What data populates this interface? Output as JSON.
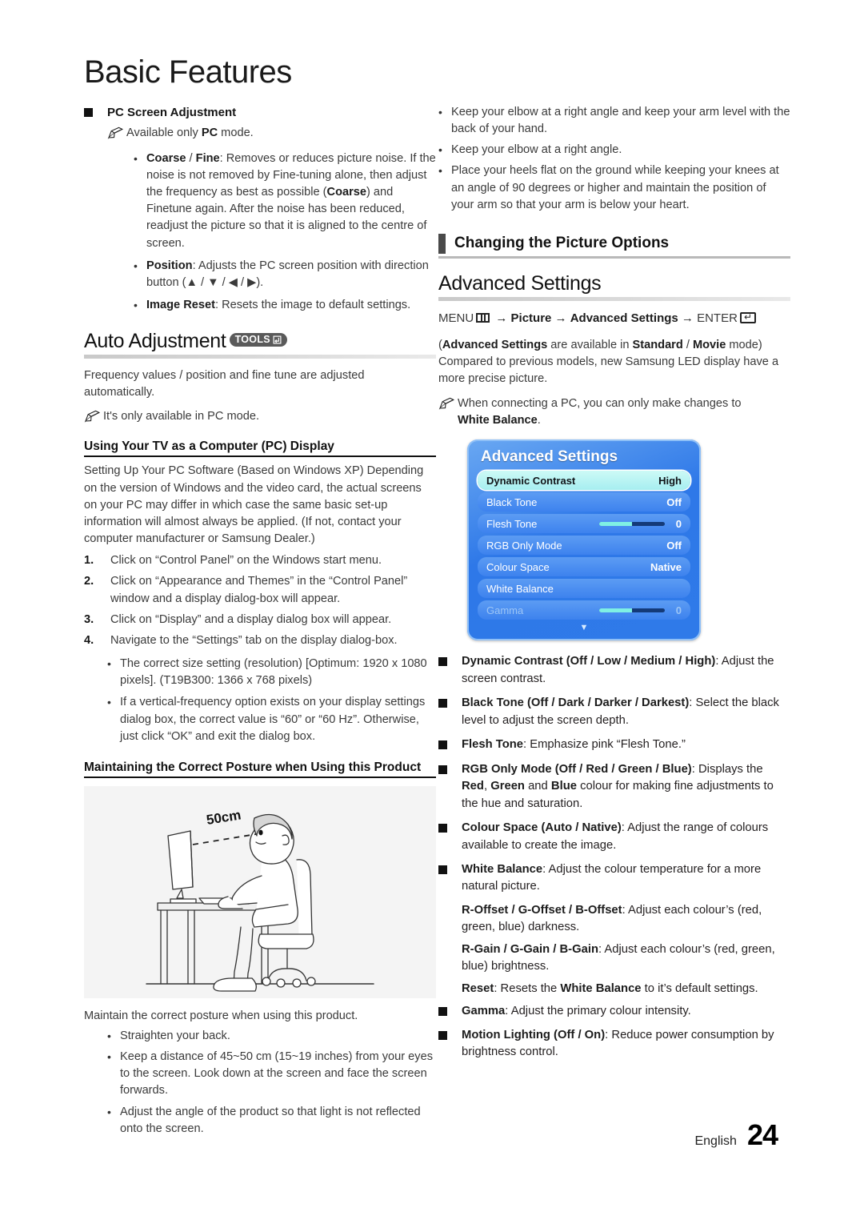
{
  "document": {
    "chapter_title": "Basic Features",
    "footer": {
      "language": "English",
      "page_number": "24"
    }
  },
  "left_column": {
    "pc_screen_adjustment": {
      "heading": "PC Screen Adjustment",
      "note": "Available only PC mode.",
      "note_bold": "PC",
      "bullets": [
        {
          "bold": "Coarse / Fine",
          "text": ": Removes or reduces picture noise. If the noise is not removed by Fine-tuning alone, then adjust the frequency as best as possible (Coarse) and Finetune again. After the noise has been reduced, readjust the picture so that it is aligned to the centre of screen."
        },
        {
          "bold": "Position",
          "text": ": Adjusts the PC screen position with direction button (▲ / ▼ / ◀ / ▶)."
        },
        {
          "bold": "Image Reset",
          "text": ": Resets the image to default settings."
        }
      ]
    },
    "auto_adjustment": {
      "title": "Auto Adjustment",
      "tools_badge": "TOOLS",
      "body": "Frequency values / position and fine tune are adjusted automatically.",
      "note": "It's only available in PC mode."
    },
    "pc_display_section": {
      "heading": "Using Your TV as a Computer (PC) Display",
      "intro": "Setting Up Your PC Software (Based on Windows XP) Depending on the version of Windows and the video card, the actual screens on your PC may differ in which case the same basic set-up information will almost always be applied. (If not, contact your computer manufacturer or Samsung Dealer.)",
      "steps": [
        {
          "num": "1.",
          "text": "Click on “Control Panel” on the Windows start menu."
        },
        {
          "num": "2.",
          "text": "Click on “Appearance and Themes” in the “Control Panel” window and a display dialog-box will appear."
        },
        {
          "num": "3.",
          "text": "Click on “Display” and a display dialog box will appear."
        },
        {
          "num": "4.",
          "text": "Navigate to the “Settings” tab on the display dialog-box."
        }
      ],
      "sub_bullets": [
        "The correct size setting (resolution) [Optimum: 1920 x 1080 pixels]. (T19B300: 1366 x 768 pixels)",
        "If a vertical-frequency option exists on your display settings dialog box, the correct value is “60” or “60 Hz”. Otherwise, just click “OK” and exit the dialog box."
      ]
    },
    "posture_section": {
      "heading": "Maintaining the Correct Posture when Using this Product",
      "illustration_label": "50cm",
      "intro": "Maintain the correct posture when using this product.",
      "bullets": [
        "Straighten your back.",
        "Keep a distance of 45~50 cm (15~19 inches) from your eyes to the screen. Look down at the screen and face the screen forwards.",
        "Adjust the angle of the product so that light is not reflected onto the screen."
      ]
    }
  },
  "right_column": {
    "posture_bullets": [
      "Keep your elbow at a right angle and keep your arm level with the back of your hand.",
      "Keep your elbow at a right angle.",
      "Place your heels flat on the ground while keeping your knees at an angle of 90 degrees or higher and maintain the position of your arm so that your arm is below your heart."
    ],
    "section_heading": "Changing the Picture Options",
    "advanced_settings": {
      "title": "Advanced Settings",
      "menu_path": {
        "menu": "MENU",
        "arrow": "→",
        "picture": "Picture",
        "advanced_settings": "Advanced Settings",
        "enter": "ENTER"
      },
      "availability": "(Advanced Settings are available in Standard / Movie mode)",
      "availability_bold_1": "Advanced Settings",
      "availability_bold_2": "Standard / Movie",
      "description": "Compared to previous models, new Samsung LED display have a more precise picture.",
      "note": "When connecting a PC, you can only make changes to White Balance.",
      "note_bold": "White Balance"
    },
    "osd_menu": {
      "title": "Advanced Settings",
      "rows": [
        {
          "name": "Dynamic Contrast",
          "value": "High",
          "type": "value",
          "state": "selected"
        },
        {
          "name": "Black Tone",
          "value": "Off",
          "type": "value",
          "state": "normal"
        },
        {
          "name": "Flesh Tone",
          "value": "0",
          "type": "slider",
          "slider_percent": 50,
          "state": "normal"
        },
        {
          "name": "RGB Only Mode",
          "value": "Off",
          "type": "value",
          "state": "normal"
        },
        {
          "name": "Colour Space",
          "value": "Native",
          "type": "value",
          "state": "normal"
        },
        {
          "name": "White Balance",
          "value": "",
          "type": "submenu",
          "state": "normal"
        },
        {
          "name": "Gamma",
          "value": "0",
          "type": "slider",
          "slider_percent": 50,
          "state": "dimmed"
        }
      ],
      "scroll_arrow": "▼",
      "colors": {
        "panel_blue": "#2f7ae9",
        "row_blue": "#4d8ef0",
        "selected_cyan": "#b8f2f0",
        "slider_fill": "#7ff0e4",
        "slider_track": "#143a78"
      }
    },
    "option_items": [
      {
        "bold": "Dynamic Contrast (Off / Low / Medium / High)",
        "text": ": Adjust the screen contrast.",
        "bulleted": true
      },
      {
        "bold": "Black Tone (Off / Dark / Darker / Darkest)",
        "text": ": Select the black level to adjust the screen depth.",
        "bulleted": true
      },
      {
        "bold": "Flesh Tone",
        "text": ": Emphasize pink “Flesh Tone.”",
        "bulleted": true
      },
      {
        "bold": "RGB Only Mode (Off / Red / Green / Blue)",
        "text": ": Displays the Red, Green and Blue colour for making fine adjustments to the hue and saturation.",
        "bulleted": true
      },
      {
        "bold": "Colour Space (Auto / Native)",
        "text": ": Adjust the range of colours available to create the image.",
        "bulleted": true
      },
      {
        "bold": "White Balance",
        "text": ": Adjust the colour temperature for a more natural picture.",
        "bulleted": true
      },
      {
        "bold": "R-Offset / G-Offset / B-Offset",
        "text": ": Adjust each colour’s (red, green, blue) darkness.",
        "bulleted": false
      },
      {
        "bold": "R-Gain / G-Gain / B-Gain",
        "text": ": Adjust each colour’s (red, green, blue) brightness.",
        "bulleted": false
      },
      {
        "bold": "Reset",
        "text": ": Resets the White Balance to it’s default settings.",
        "bulleted": false
      },
      {
        "bold": "Gamma",
        "text": ": Adjust the primary colour intensity.",
        "bulleted": true
      },
      {
        "bold": "Motion Lighting (Off / On)",
        "text": ": Reduce power consumption by brightness control.",
        "bulleted": true
      }
    ]
  }
}
